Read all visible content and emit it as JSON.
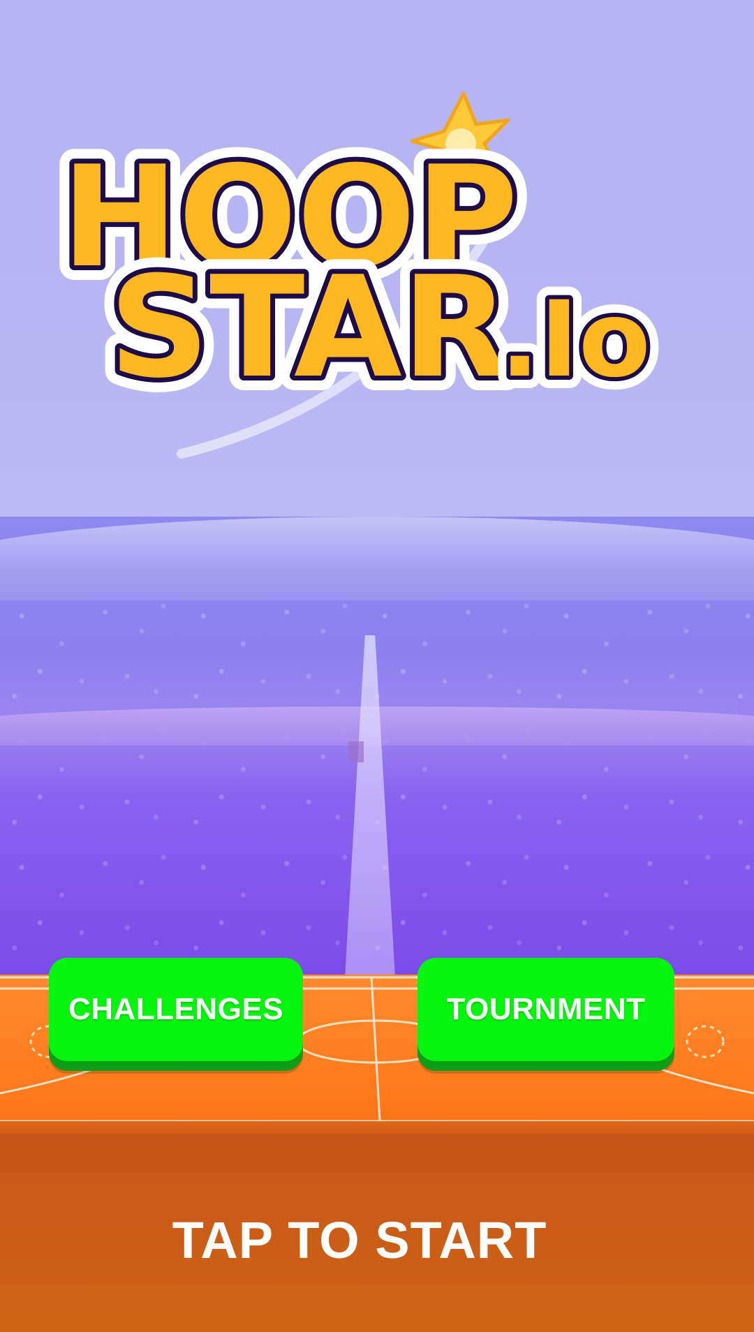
{
  "logo": {
    "line1": "HOOP",
    "line2": "STAR",
    "suffix": ".Io"
  },
  "buttons": {
    "challenges": "CHALLENGES",
    "tournament": "TOURNMENT"
  },
  "tap_to_start": "TAP TO START",
  "colors": {
    "sky": "#b6b3f2",
    "logo_fill": "#ffb81f",
    "logo_outline": "#1e0c4a",
    "button_green": "#05f50f",
    "button_shadow": "#0d9d16",
    "court_orange": "#ff7d1e",
    "ground": "#c95a17"
  },
  "icons": [
    "star-icon"
  ]
}
